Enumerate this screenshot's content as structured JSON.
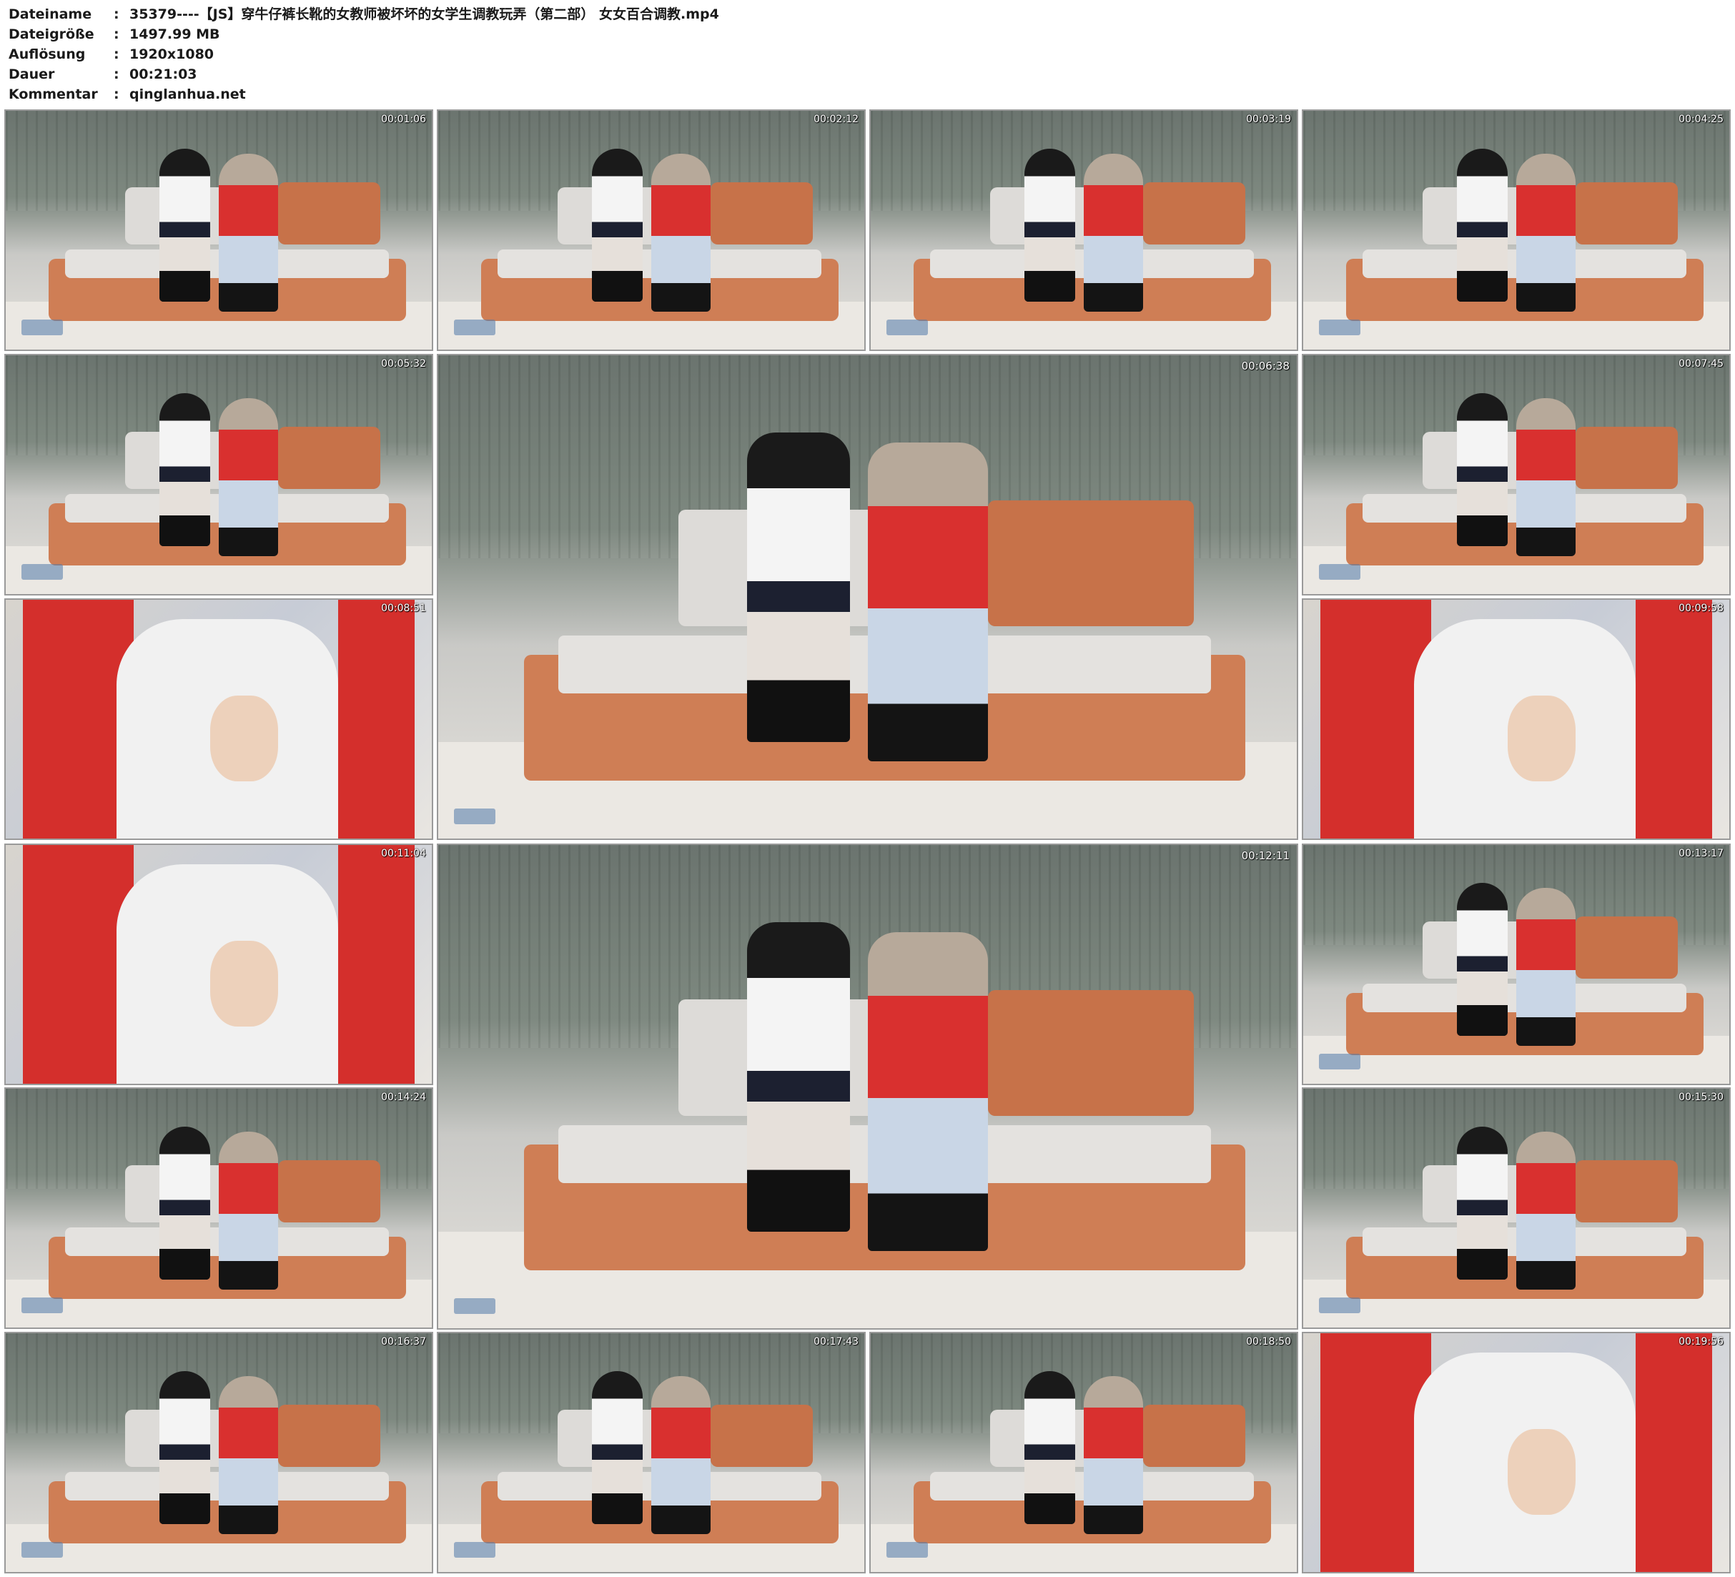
{
  "meta": [
    {
      "key": "Dateiname",
      "sep": ":",
      "value": "35379----【JS】穿牛仔裤长靴的女教师被坏坏的女学生调教玩弄（第二部） 女女百合调教.mp4"
    },
    {
      "key": "Dateigröße",
      "sep": ":",
      "value": "1497.99 MB"
    },
    {
      "key": "Auflösung",
      "sep": ":",
      "value": "1920x1080"
    },
    {
      "key": "Dauer",
      "sep": ":",
      "value": "00:21:03"
    },
    {
      "key": "Kommentar",
      "sep": ":",
      "value": "qinglanhua.net"
    }
  ],
  "thumbnails": [
    {
      "timestamp": "00:01:06",
      "scene": "sofa-wide"
    },
    {
      "timestamp": "00:02:12",
      "scene": "sofa-close"
    },
    {
      "timestamp": "00:03:19",
      "scene": "sofa-wide"
    },
    {
      "timestamp": "00:04:25",
      "scene": "sofa-wide"
    },
    {
      "timestamp": "00:05:32",
      "scene": "sofa-wide"
    },
    {
      "timestamp": "00:06:38",
      "scene": "sofa-wide-large"
    },
    {
      "timestamp": "00:07:45",
      "scene": "sofa-wide"
    },
    {
      "timestamp": "00:08:51",
      "scene": "closeup"
    },
    {
      "timestamp": "00:09:58",
      "scene": "closeup"
    },
    {
      "timestamp": "00:11:04",
      "scene": "closeup"
    },
    {
      "timestamp": "00:12:11",
      "scene": "sofa-wide-large"
    },
    {
      "timestamp": "00:13:17",
      "scene": "sofa-wide"
    },
    {
      "timestamp": "00:14:24",
      "scene": "sofa-wide"
    },
    {
      "timestamp": "00:15:30",
      "scene": "sofa-wide"
    },
    {
      "timestamp": "00:16:37",
      "scene": "sofa-wide"
    },
    {
      "timestamp": "00:17:43",
      "scene": "sofa-wide"
    },
    {
      "timestamp": "00:18:50",
      "scene": "sofa-wide"
    },
    {
      "timestamp": "00:19:56",
      "scene": "closeup"
    }
  ]
}
